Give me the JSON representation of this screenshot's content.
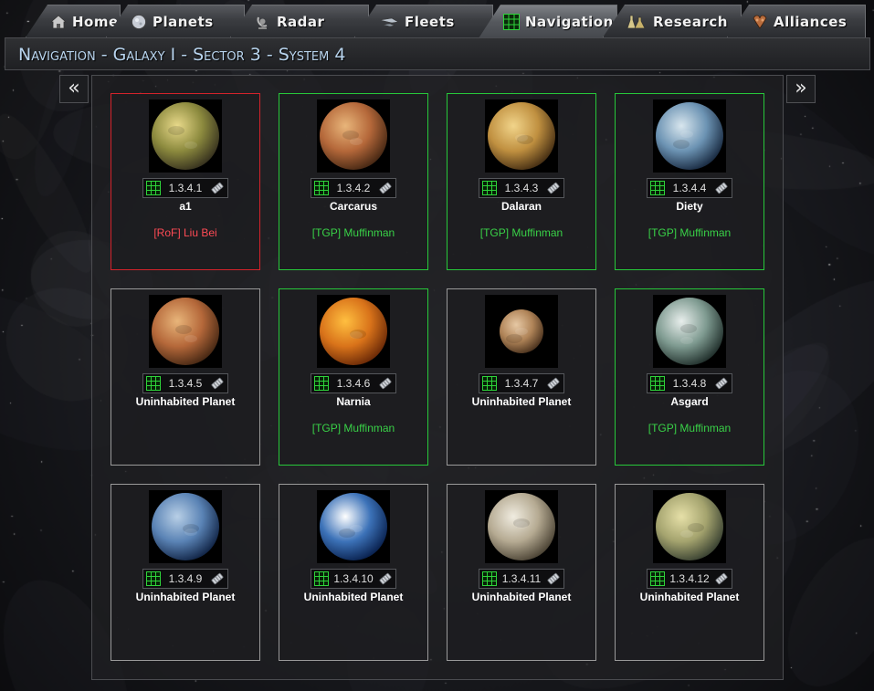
{
  "tabs": [
    {
      "label": "Home",
      "icon": "home-icon"
    },
    {
      "label": "Planets",
      "icon": "planet-icon"
    },
    {
      "label": "Radar",
      "icon": "radar-icon"
    },
    {
      "label": "Fleets",
      "icon": "fleet-icon"
    },
    {
      "label": "Navigation",
      "icon": "navigation-grid-icon",
      "active": true
    },
    {
      "label": "Research",
      "icon": "research-flasks-icon"
    },
    {
      "label": "Alliances",
      "icon": "alliance-icon"
    }
  ],
  "header": {
    "breadcrumb": "Navigation - Galaxy I - Sector 3 - System 4"
  },
  "nav": {
    "prev_label": "«",
    "next_label": "»"
  },
  "colors": {
    "own_border": "#27c83a",
    "enemy_border": "#d4232b",
    "neutral_border": "#9a9a9a",
    "own_text": "#39d147",
    "enemy_text": "#ff4b55",
    "breadcrumb_text": "#b8d4ee"
  },
  "planets": [
    {
      "coords": "1.3.4.1",
      "name": "a1",
      "owner": "[RoF] Liu Bei",
      "status": "enemy",
      "palette": [
        "#e8d98a",
        "#8c8a3e",
        "#3a3520"
      ]
    },
    {
      "coords": "1.3.4.2",
      "name": "Carcarus",
      "owner": "[TGP] Muffinman",
      "status": "own",
      "palette": [
        "#e8b57a",
        "#b5683a",
        "#4a2a15"
      ]
    },
    {
      "coords": "1.3.4.3",
      "name": "Dalaran",
      "owner": "[TGP] Muffinman",
      "status": "own",
      "palette": [
        "#f1d48a",
        "#c09040",
        "#4a3215"
      ]
    },
    {
      "coords": "1.3.4.4",
      "name": "Diety",
      "owner": "[TGP] Muffinman",
      "status": "own",
      "palette": [
        "#d8e6ee",
        "#6c93b3",
        "#1c2e45"
      ]
    },
    {
      "coords": "1.3.4.5",
      "name": "Uninhabited Planet",
      "owner": "",
      "status": "none",
      "palette": [
        "#e8b57a",
        "#b5683a",
        "#4a2a15"
      ]
    },
    {
      "coords": "1.3.4.6",
      "name": "Narnia",
      "owner": "[TGP] Muffinman",
      "status": "own",
      "palette": [
        "#ffbf40",
        "#d9731a",
        "#6e2c08"
      ]
    },
    {
      "coords": "1.3.4.7",
      "name": "Uninhabited Planet",
      "owner": "",
      "status": "none",
      "palette": [
        "#e6c8a4",
        "#b08458",
        "#4e3520"
      ]
    },
    {
      "coords": "1.3.4.8",
      "name": "Asgard",
      "owner": "[TGP] Muffinman",
      "status": "own",
      "palette": [
        "#e8eeec",
        "#7e9a90",
        "#24332f"
      ]
    },
    {
      "coords": "1.3.4.9",
      "name": "Uninhabited Planet",
      "owner": "",
      "status": "none",
      "palette": [
        "#b8cfe6",
        "#5a83b5",
        "#14284a"
      ]
    },
    {
      "coords": "1.3.4.10",
      "name": "Uninhabited Planet",
      "owner": "",
      "status": "none",
      "palette": [
        "#ffffff",
        "#3c72b8",
        "#0b2452"
      ]
    },
    {
      "coords": "1.3.4.11",
      "name": "Uninhabited Planet",
      "owner": "",
      "status": "none",
      "palette": [
        "#f0ece0",
        "#b5aa92",
        "#4f4738"
      ]
    },
    {
      "coords": "1.3.4.12",
      "name": "Uninhabited Planet",
      "owner": "",
      "status": "none",
      "palette": [
        "#e6e0a8",
        "#a4a36e",
        "#3d4534"
      ]
    }
  ]
}
